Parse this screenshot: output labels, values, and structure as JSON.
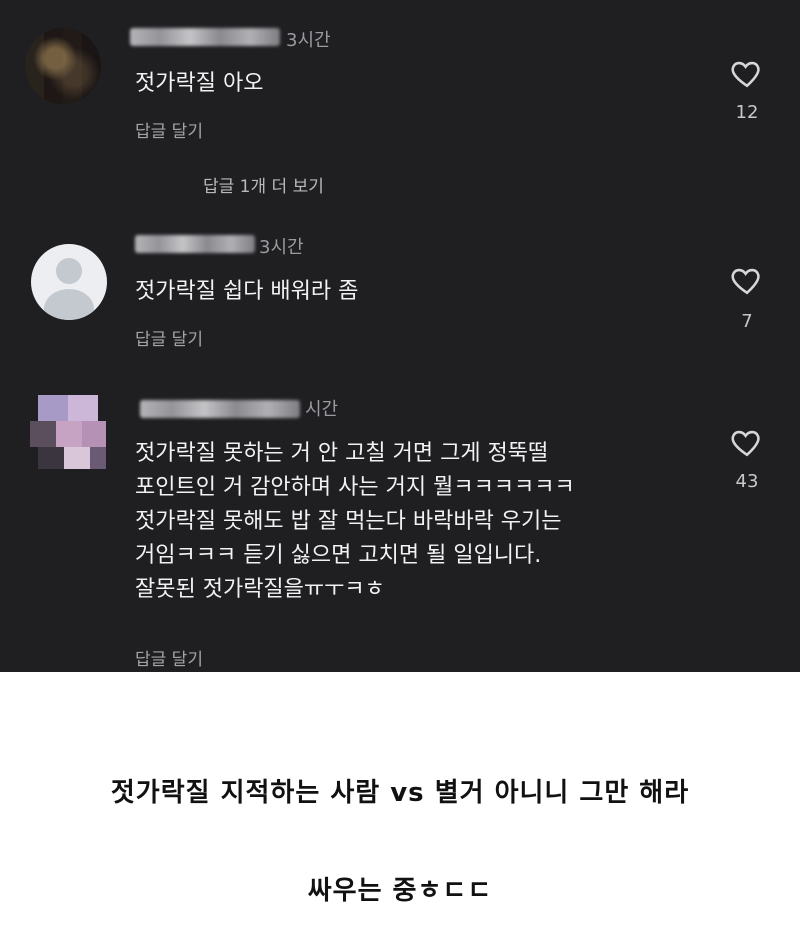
{
  "comments": [
    {
      "time": "3시간",
      "text": "젓가락질 아오",
      "reply_label": "답글 달기",
      "likes": "12",
      "more_replies": "답글 1개 더 보기"
    },
    {
      "time": "3시간",
      "text": "젓가락질 쉽다 배워라 좀",
      "reply_label": "답글 달기",
      "likes": "7"
    },
    {
      "time": "시간",
      "text": "젓가락질 못하는 거 안 고칠 거면 그게 정뚝떨\n포인트인 거 감안하며 사는 거지 뭘ㅋㅋㅋㅋㅋㅋ\n젓가락질 못해도 밥 잘 먹는다 바락바락 우기는\n거임ㅋㅋㅋ 듣기 싫으면 고치면 될 일입니다.\n잘못된 젓가락질을ㅠㅜㅋㅎ",
      "reply_label": "답글 달기",
      "likes": "43"
    }
  ],
  "caption": {
    "line1": "젓가락질 지적하는 사람 vs 별거 아니니 그만 해라",
    "line2": "싸우는 중ㅎㄷㄷ"
  },
  "icons": {
    "heart": "heart-outline-icon",
    "avatar_default": "default-avatar-icon"
  },
  "colors": {
    "background": "#1f1f22",
    "text": "#f2f2f2",
    "muted": "#9a9aa0"
  }
}
